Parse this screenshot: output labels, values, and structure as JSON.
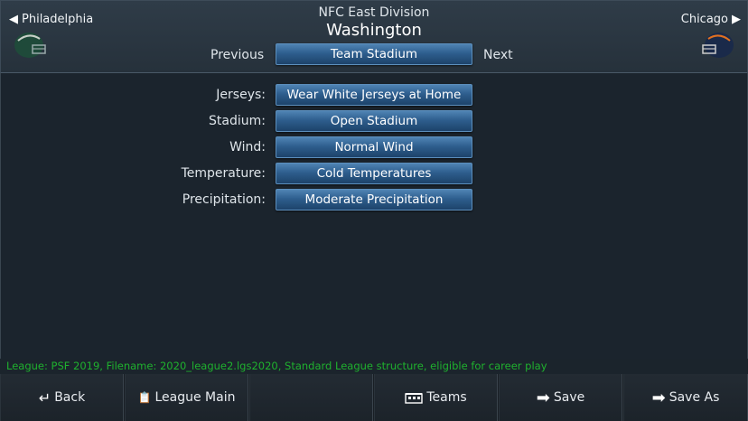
{
  "header": {
    "division": "NFC East Division",
    "team": "Washington",
    "prev_team": "Philadelphia",
    "next_team": "Chicago",
    "prev_label": "Previous",
    "next_label": "Next",
    "view_button": "Team Stadium"
  },
  "settings": [
    {
      "label": "Jerseys:",
      "value": "Wear White Jerseys at Home"
    },
    {
      "label": "Stadium:",
      "value": "Open Stadium"
    },
    {
      "label": "Wind:",
      "value": "Normal Wind"
    },
    {
      "label": "Temperature:",
      "value": "Cold Temperatures"
    },
    {
      "label": "Precipitation:",
      "value": "Moderate Precipitation"
    }
  ],
  "status_line": "League: PSF 2019,  Filename: 2020_league2.lgs2020,  Standard League structure, eligible for career play",
  "footer": {
    "back": "Back",
    "league_main": "League Main",
    "teams": "Teams",
    "save": "Save",
    "save_as": "Save As"
  },
  "colors": {
    "accent_button": "#2e5e8e",
    "status_text": "#1fb12e",
    "background": "#1b242c"
  }
}
